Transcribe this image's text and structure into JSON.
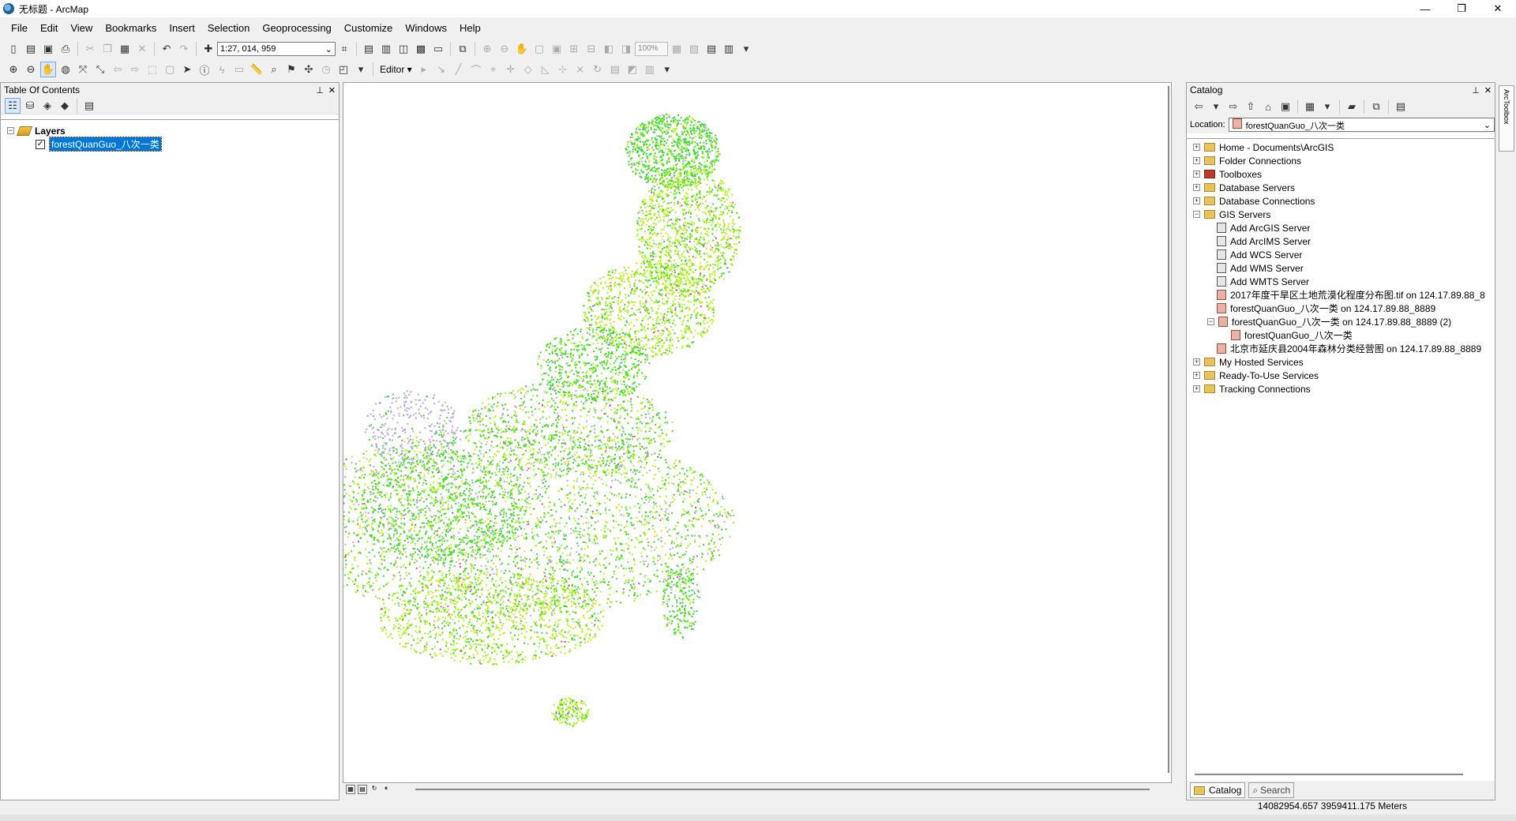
{
  "window": {
    "title": "无标题 - ArcMap",
    "minimize": "—",
    "maximize": "❐",
    "close": "✕"
  },
  "menu": [
    "File",
    "Edit",
    "View",
    "Bookmarks",
    "Insert",
    "Selection",
    "Geoprocessing",
    "Customize",
    "Windows",
    "Help"
  ],
  "toolbar": {
    "scale": "1:27, 014, 959",
    "zoom_percent": "100%",
    "editor_label": "Editor ▾"
  },
  "toc": {
    "title": "Table Of Contents",
    "pin": "⊥",
    "close": "✕",
    "root_label": "Layers",
    "layer_label": "forestQuanGuo_八次一类",
    "layer_checked": "✓"
  },
  "catalog": {
    "title": "Catalog",
    "location_label": "Location:",
    "location_value": "forestQuanGuo_八次一类",
    "items": {
      "home": "Home - Documents\\ArcGIS",
      "folder_connections": "Folder Connections",
      "toolboxes": "Toolboxes",
      "database_servers": "Database Servers",
      "database_connections": "Database Connections",
      "gis_servers": "GIS Servers",
      "add_arcgis": "Add ArcGIS Server",
      "add_arcims": "Add ArcIMS Server",
      "add_wcs": "Add WCS Server",
      "add_wms": "Add WMS Server",
      "add_wmts": "Add WMTS Server",
      "svc1": "2017年度干旱区土地荒漠化程度分布图.tif on 124.17.89.88_8",
      "svc2": "forestQuanGuo_八次一类 on 124.17.89.88_8889",
      "svc3": "forestQuanGuo_八次一类 on 124.17.89.88_8889 (2)",
      "svc3_child": "forestQuanGuo_八次一类",
      "svc4": "北京市延庆县2004年森林分类经营图 on 124.17.89.88_8889",
      "my_hosted": "My Hosted Services",
      "ready_to_use": "Ready-To-Use Services",
      "tracking": "Tracking Connections"
    },
    "tab_catalog": "Catalog",
    "tab_search": "Search",
    "side_strip": "ArcToolbox"
  },
  "status": {
    "coordinates": "14082954.657  3959411.175 Meters"
  },
  "colors": {
    "forest_green": "#3ddc2b",
    "forest_lime": "#b7f21a",
    "shrub_lavender": "#b9a4f0",
    "accent_magenta": "#e040c0"
  }
}
